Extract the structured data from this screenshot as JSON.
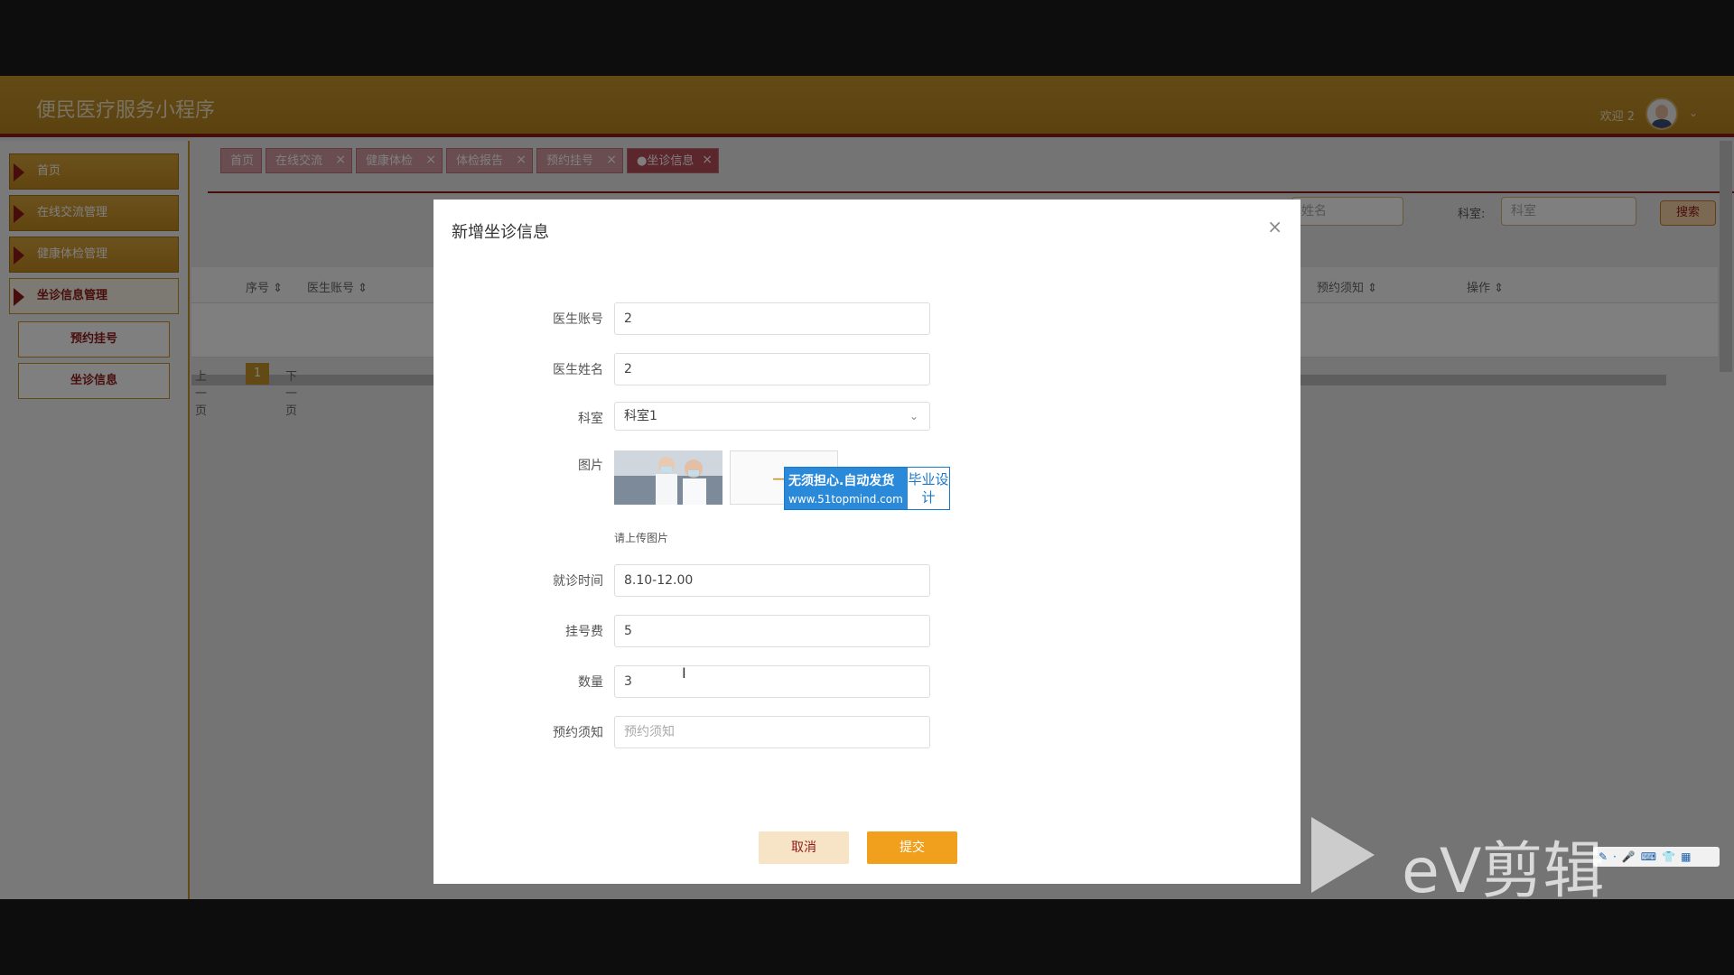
{
  "header": {
    "title": "便民医疗服务小程序",
    "welcome": "欢迎 2",
    "avatar_caret": "⌄"
  },
  "sidebar": {
    "items": [
      {
        "label": "首页"
      },
      {
        "label": "在线交流管理"
      },
      {
        "label": "健康体检管理"
      },
      {
        "label": "坐诊信息管理"
      }
    ],
    "subitems": [
      {
        "label": "预约挂号"
      },
      {
        "label": "坐诊信息"
      }
    ]
  },
  "tabs": [
    {
      "label": "首页"
    },
    {
      "label": "在线交流"
    },
    {
      "label": "健康体检"
    },
    {
      "label": "体检报告"
    },
    {
      "label": "预约挂号"
    },
    {
      "label": "●坐诊信息"
    }
  ],
  "tab_close": "×",
  "search": {
    "name_placeholder": "姓名",
    "dept_label": "科室:",
    "dept_placeholder": "科室",
    "button": "搜索"
  },
  "table": {
    "headers": [
      "序号 ⇕",
      "医生账号 ⇕",
      "预约须知 ⇕",
      "操作 ⇕"
    ]
  },
  "pager": {
    "prev": "上一页",
    "current": "1",
    "next": "下一页"
  },
  "modal": {
    "title": "新增坐诊信息",
    "close": "×",
    "fields": {
      "account": {
        "label": "医生账号",
        "value": "2"
      },
      "name": {
        "label": "医生姓名",
        "value": "2"
      },
      "dept": {
        "label": "科室",
        "value": "科室1"
      },
      "image": {
        "label": "图片",
        "hint": "请上传图片"
      },
      "time": {
        "label": "就诊时间",
        "value": "8.10-12.00"
      },
      "fee": {
        "label": "挂号费",
        "value": "5"
      },
      "count": {
        "label": "数量",
        "value": "3"
      },
      "notice": {
        "label": "预约须知",
        "placeholder": "预约须知"
      }
    },
    "cancel": "取消",
    "submit": "提交"
  },
  "watermark": {
    "main": "无须担心.自动发货",
    "url": "www.51topmind.com",
    "side": "毕业设计"
  },
  "ev": {
    "text": "eV剪辑"
  },
  "colors": {
    "header": "#c6952b",
    "accent": "#8e1a1a",
    "submit": "#f0a01c",
    "cancel": "#f7e3c5"
  }
}
